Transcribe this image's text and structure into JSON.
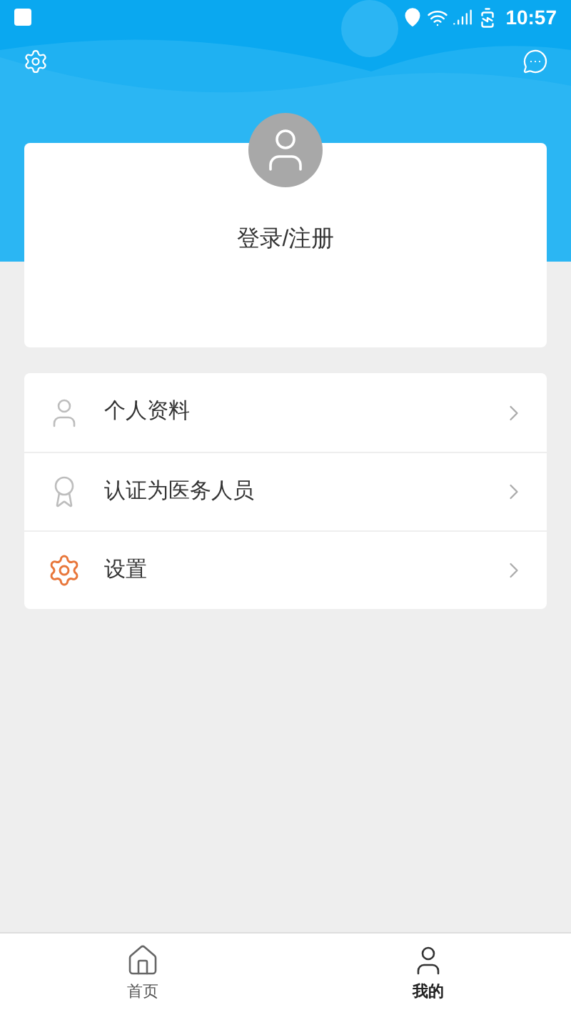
{
  "status_bar": {
    "time": "10:57"
  },
  "profile": {
    "login_label": "登录/注册"
  },
  "menu": [
    {
      "label": "个人资料",
      "kind": "profile"
    },
    {
      "label": "认证为医务人员",
      "kind": "certify"
    },
    {
      "label": "设置",
      "kind": "settings"
    }
  ],
  "tabs": [
    {
      "label": "首页",
      "kind": "home",
      "selected": false
    },
    {
      "label": "我的",
      "kind": "me",
      "selected": true
    }
  ]
}
